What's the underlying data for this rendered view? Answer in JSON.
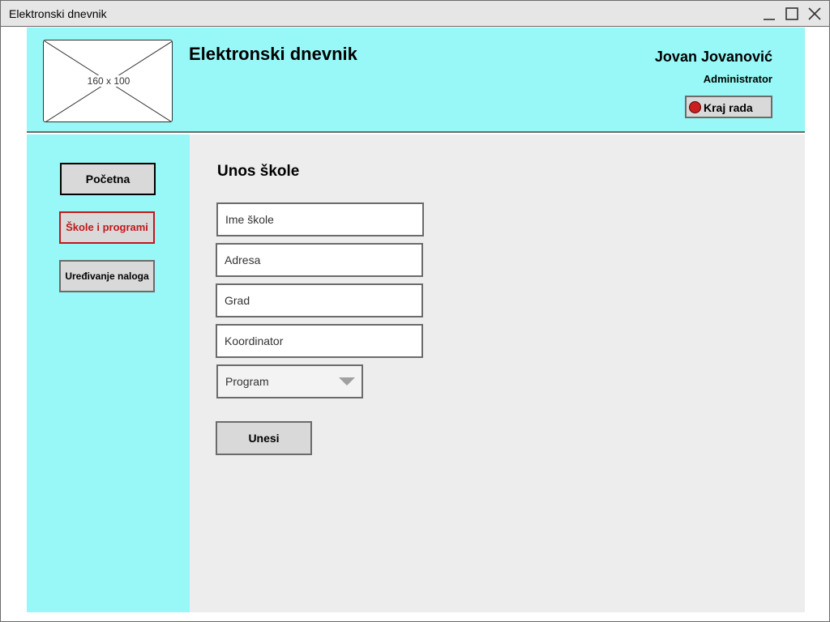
{
  "window": {
    "title": "Elektronski dnevnik"
  },
  "header": {
    "logo_placeholder": "160 x 100",
    "app_title": "Elektronski dnevnik",
    "user_name": "Jovan Jovanović",
    "user_role": "Administrator",
    "logout_label": "Kraj rada"
  },
  "sidebar": {
    "items": [
      {
        "label": "Početna"
      },
      {
        "label": "Škole i programi"
      },
      {
        "label": "Uređivanje naloga"
      }
    ]
  },
  "form": {
    "title": "Unos škole",
    "fields": [
      {
        "placeholder": "Ime škole"
      },
      {
        "placeholder": "Adresa"
      },
      {
        "placeholder": "Grad"
      },
      {
        "placeholder": "Koordinator"
      }
    ],
    "program_select": "Program",
    "submit_label": "Unesi"
  },
  "colors": {
    "accent": "#98f7f7",
    "active_nav": "#c0191a",
    "logout_dot": "#cc1f1f"
  },
  "icons": [
    "minimize-icon",
    "maximize-icon",
    "close-icon",
    "logout-dot-icon",
    "dropdown-caret-icon"
  ]
}
